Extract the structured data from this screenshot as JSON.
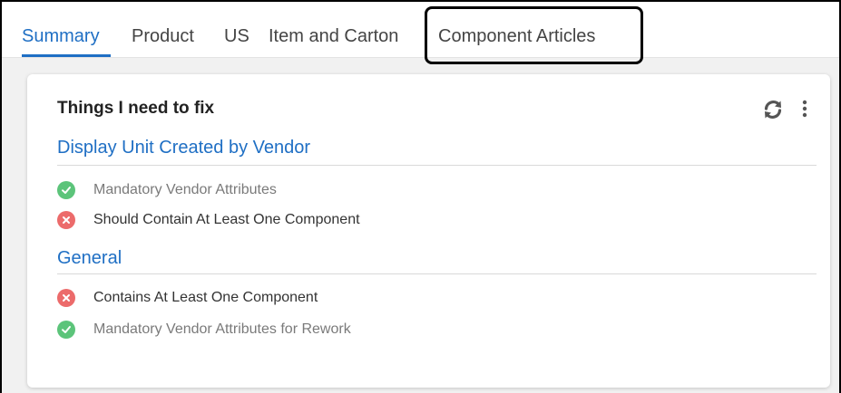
{
  "tabs": [
    {
      "label": "Summary",
      "active": true
    },
    {
      "label": "Product",
      "active": false
    },
    {
      "label": "US",
      "active": false
    },
    {
      "label": "Item and Carton",
      "active": false
    },
    {
      "label": "Component Articles",
      "active": false
    }
  ],
  "card": {
    "title": "Things I need to fix",
    "actions": [
      "refresh-icon",
      "more-vertical-icon"
    ],
    "sections": [
      {
        "title": "Display Unit Created by Vendor",
        "rules": [
          {
            "label": "Mandatory Vendor Attributes",
            "status": "pass"
          },
          {
            "label": "Should Contain At Least One Component",
            "status": "fail"
          }
        ]
      },
      {
        "title": "General",
        "rules": [
          {
            "label": "Contains At Least One Component",
            "status": "fail"
          },
          {
            "label": "Mandatory Vendor Attributes for Rework",
            "status": "pass"
          }
        ]
      }
    ]
  },
  "colors": {
    "accent": "#1f6fc4",
    "pass": "#5cc47a",
    "fail": "#ec6b6b"
  }
}
